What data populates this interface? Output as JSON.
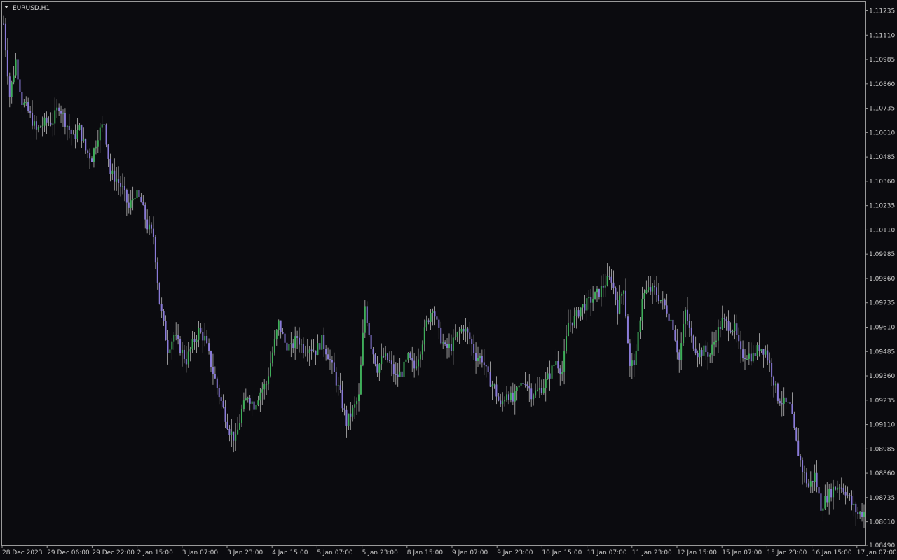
{
  "window": {
    "symbol_title": "EURUSD,H1",
    "background_color": "#0b0b0f",
    "frame_color": "#9a9a9a",
    "candle_up_color": "#3fae5a",
    "candle_down_color": "#8a7bd8",
    "wick_color": "#b8b8b8",
    "dropdown_icon": "triangle-down-icon"
  },
  "chart_data": {
    "type": "candlestick",
    "title": "EURUSD,H1",
    "timeframe": "H1",
    "ylim": [
      1.0849,
      1.1128
    ],
    "y_ticks": [
      "1.11235",
      "1.11110",
      "1.10985",
      "1.10860",
      "1.10735",
      "1.10610",
      "1.10485",
      "1.10360",
      "1.10235",
      "1.10110",
      "1.09985",
      "1.09860",
      "1.09735",
      "1.09610",
      "1.09485",
      "1.09360",
      "1.09235",
      "1.09110",
      "1.08985",
      "1.08860",
      "1.08735",
      "1.08610",
      "1.08490"
    ],
    "x_ticks": [
      "28 Dec 2023",
      "29 Dec 06:00",
      "29 Dec 22:00",
      "2 Jan 15:00",
      "3 Jan 07:00",
      "3 Jan 23:00",
      "4 Jan 15:00",
      "5 Jan 07:00",
      "5 Jan 23:00",
      "8 Jan 15:00",
      "9 Jan 07:00",
      "9 Jan 23:00",
      "10 Jan 15:00",
      "11 Jan 07:00",
      "11 Jan 23:00",
      "12 Jan 15:00",
      "15 Jan 07:00",
      "15 Jan 23:00",
      "16 Jan 15:00",
      "17 Jan 07:00"
    ],
    "price_path": [
      [
        0,
        1.1117
      ],
      [
        3,
        1.108
      ],
      [
        6,
        1.1098
      ],
      [
        9,
        1.1077
      ],
      [
        12,
        1.1072
      ],
      [
        16,
        1.1062
      ],
      [
        20,
        1.1066
      ],
      [
        24,
        1.1067
      ],
      [
        27,
        1.1075
      ],
      [
        30,
        1.1067
      ],
      [
        34,
        1.1058
      ],
      [
        37,
        1.1063
      ],
      [
        40,
        1.1052
      ],
      [
        43,
        1.1048
      ],
      [
        46,
        1.106
      ],
      [
        49,
        1.1066
      ],
      [
        52,
        1.104
      ],
      [
        55,
        1.1037
      ],
      [
        58,
        1.1032
      ],
      [
        61,
        1.1022
      ],
      [
        64,
        1.103
      ],
      [
        67,
        1.1025
      ],
      [
        70,
        1.1013
      ],
      [
        73,
        1.1008
      ],
      [
        76,
        1.0974
      ],
      [
        80,
        1.095
      ],
      [
        83,
        1.0957
      ],
      [
        86,
        1.095
      ],
      [
        89,
        1.0944
      ],
      [
        92,
        1.0952
      ],
      [
        95,
        1.0959
      ],
      [
        98,
        1.0955
      ],
      [
        101,
        1.0942
      ],
      [
        104,
        1.093
      ],
      [
        107,
        1.0919
      ],
      [
        110,
        1.0908
      ],
      [
        113,
        1.0903
      ],
      [
        116,
        1.0918
      ],
      [
        119,
        1.0926
      ],
      [
        122,
        1.0921
      ],
      [
        125,
        1.0928
      ],
      [
        128,
        1.0932
      ],
      [
        131,
        1.0948
      ],
      [
        134,
        1.0963
      ],
      [
        137,
        1.0953
      ],
      [
        140,
        1.095
      ],
      [
        143,
        1.0956
      ],
      [
        146,
        1.095
      ],
      [
        149,
        1.0951
      ],
      [
        152,
        1.0949
      ],
      [
        155,
        1.0954
      ],
      [
        158,
        1.0947
      ],
      [
        161,
        1.0937
      ],
      [
        164,
        1.0926
      ],
      [
        167,
        1.0912
      ],
      [
        170,
        1.0918
      ],
      [
        173,
        1.0925
      ],
      [
        176,
        1.0972
      ],
      [
        179,
        1.0952
      ],
      [
        182,
        1.094
      ],
      [
        185,
        1.0946
      ],
      [
        188,
        1.0943
      ],
      [
        191,
        1.0935
      ],
      [
        194,
        1.0938
      ],
      [
        197,
        1.0945
      ],
      [
        200,
        1.094
      ],
      [
        203,
        1.095
      ],
      [
        206,
        1.0963
      ],
      [
        209,
        1.0972
      ],
      [
        212,
        1.0958
      ],
      [
        215,
        1.095
      ],
      [
        218,
        1.0951
      ],
      [
        221,
        1.0957
      ],
      [
        224,
        1.0961
      ],
      [
        227,
        1.0955
      ],
      [
        230,
        1.0946
      ],
      [
        233,
        1.0945
      ],
      [
        236,
        1.0935
      ],
      [
        239,
        1.093
      ],
      [
        242,
        1.092
      ],
      [
        245,
        1.0928
      ],
      [
        248,
        1.0923
      ],
      [
        251,
        1.093
      ],
      [
        254,
        1.0934
      ],
      [
        257,
        1.0927
      ],
      [
        260,
        1.0928
      ],
      [
        263,
        1.0931
      ],
      [
        266,
        1.0937
      ],
      [
        269,
        1.0944
      ],
      [
        272,
        1.0938
      ],
      [
        275,
        1.0963
      ],
      [
        278,
        1.0965
      ],
      [
        281,
        1.0971
      ],
      [
        284,
        1.0973
      ],
      [
        287,
        1.0976
      ],
      [
        290,
        1.0979
      ],
      [
        293,
        1.0984
      ],
      [
        296,
        1.0986
      ],
      [
        299,
        1.0971
      ],
      [
        302,
        1.0982
      ],
      [
        305,
        1.094
      ],
      [
        308,
        1.0946
      ],
      [
        311,
        1.0977
      ],
      [
        314,
        1.098
      ],
      [
        317,
        1.098
      ],
      [
        320,
        1.0975
      ],
      [
        323,
        1.097
      ],
      [
        326,
        1.0962
      ],
      [
        329,
        1.0944
      ],
      [
        332,
        1.0969
      ],
      [
        335,
        1.0955
      ],
      [
        338,
        1.0948
      ],
      [
        341,
        1.0949
      ],
      [
        344,
        1.0947
      ],
      [
        347,
        1.0957
      ],
      [
        350,
        1.0964
      ],
      [
        353,
        1.0962
      ],
      [
        356,
        1.096
      ],
      [
        359,
        1.0947
      ],
      [
        362,
        1.0947
      ],
      [
        365,
        1.0946
      ],
      [
        368,
        1.0951
      ],
      [
        371,
        1.0949
      ],
      [
        374,
        1.0938
      ],
      [
        377,
        1.0925
      ],
      [
        380,
        1.0922
      ],
      [
        383,
        1.092
      ],
      [
        386,
        1.0901
      ],
      [
        389,
        1.0888
      ],
      [
        392,
        1.0879
      ],
      [
        395,
        1.0885
      ],
      [
        398,
        1.0869
      ],
      [
        401,
        1.0874
      ],
      [
        404,
        1.0878
      ],
      [
        407,
        1.088
      ],
      [
        410,
        1.0877
      ],
      [
        413,
        1.087
      ],
      [
        416,
        1.0865
      ],
      [
        419,
        1.0866
      ]
    ]
  }
}
